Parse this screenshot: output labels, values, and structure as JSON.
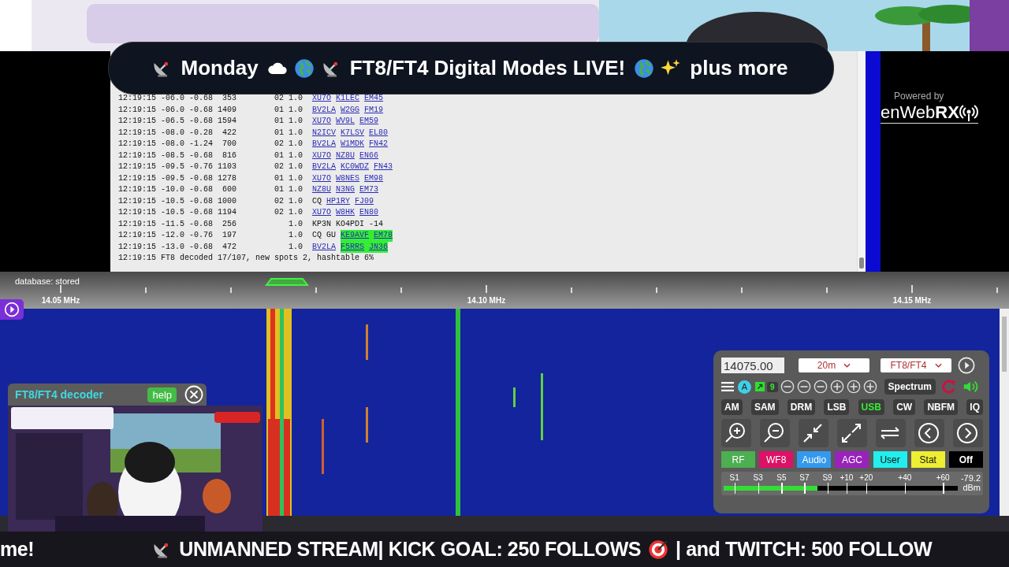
{
  "title": {
    "day": "Monday",
    "headline": "FT8/FT4 Digital Modes LIVE!",
    "tail": "plus more"
  },
  "log": {
    "rows": [
      {
        "time": "12:19:15",
        "snr": "-06.0",
        "dt": "-0.68",
        "freq": "353",
        "col_5": "02",
        "col_6": "1.0",
        "message": [
          {
            "text": "XU7O",
            "link": true,
            "highlight": false
          },
          {
            "text": "K1LEC",
            "link": true,
            "highlight": false
          },
          {
            "text": "EM45",
            "link": true,
            "highlight": false
          }
        ]
      },
      {
        "time": "12:19:15",
        "snr": "-06.0",
        "dt": "-0.68",
        "freq": "1409",
        "col_5": "01",
        "col_6": "1.0",
        "message": [
          {
            "text": "BV2LA",
            "link": true,
            "highlight": false
          },
          {
            "text": "W2GG",
            "link": true,
            "highlight": false
          },
          {
            "text": "FM19",
            "link": true,
            "highlight": false
          }
        ]
      },
      {
        "time": "12:19:15",
        "snr": "-06.5",
        "dt": "-0.68",
        "freq": "1594",
        "col_5": "01",
        "col_6": "1.0",
        "message": [
          {
            "text": "XU7O",
            "link": true,
            "highlight": false
          },
          {
            "text": "WV9L",
            "link": true,
            "highlight": false
          },
          {
            "text": "EM59",
            "link": true,
            "highlight": false
          }
        ]
      },
      {
        "time": "12:19:15",
        "snr": "-08.0",
        "dt": "-0.28",
        "freq": "422",
        "col_5": "01",
        "col_6": "1.0",
        "message": [
          {
            "text": "N2ICV",
            "link": true,
            "highlight": false
          },
          {
            "text": "K7LSV",
            "link": true,
            "highlight": false
          },
          {
            "text": "EL80",
            "link": true,
            "highlight": false
          }
        ]
      },
      {
        "time": "12:19:15",
        "snr": "-08.0",
        "dt": "-1.24",
        "freq": "700",
        "col_5": "02",
        "col_6": "1.0",
        "message": [
          {
            "text": "BV2LA",
            "link": true,
            "highlight": false
          },
          {
            "text": "W1MDK",
            "link": true,
            "highlight": false
          },
          {
            "text": "FN42",
            "link": true,
            "highlight": false
          }
        ]
      },
      {
        "time": "12:19:15",
        "snr": "-08.5",
        "dt": "-0.68",
        "freq": "816",
        "col_5": "01",
        "col_6": "1.0",
        "message": [
          {
            "text": "XU7O",
            "link": true,
            "highlight": false
          },
          {
            "text": "NZ8U",
            "link": true,
            "highlight": false
          },
          {
            "text": "EN66",
            "link": true,
            "highlight": false
          }
        ]
      },
      {
        "time": "12:19:15",
        "snr": "-09.5",
        "dt": "-0.76",
        "freq": "1103",
        "col_5": "02",
        "col_6": "1.0",
        "message": [
          {
            "text": "BV2LA",
            "link": true,
            "highlight": false
          },
          {
            "text": "KC0WDZ",
            "link": true,
            "highlight": false
          },
          {
            "text": "FN43",
            "link": true,
            "highlight": false
          }
        ]
      },
      {
        "time": "12:19:15",
        "snr": "-09.5",
        "dt": "-0.68",
        "freq": "1278",
        "col_5": "01",
        "col_6": "1.0",
        "message": [
          {
            "text": "XU7O",
            "link": true,
            "highlight": false
          },
          {
            "text": "W8NES",
            "link": true,
            "highlight": false
          },
          {
            "text": "EM98",
            "link": true,
            "highlight": false
          }
        ]
      },
      {
        "time": "12:19:15",
        "snr": "-10.0",
        "dt": "-0.68",
        "freq": "600",
        "col_5": "01",
        "col_6": "1.0",
        "message": [
          {
            "text": "NZ8U",
            "link": true,
            "highlight": false
          },
          {
            "text": "N3NG",
            "link": true,
            "highlight": false
          },
          {
            "text": "EM73",
            "link": true,
            "highlight": false
          }
        ]
      },
      {
        "time": "12:19:15",
        "snr": "-10.5",
        "dt": "-0.68",
        "freq": "1000",
        "col_5": "02",
        "col_6": "1.0",
        "message": [
          {
            "text": "CQ",
            "link": false,
            "highlight": false
          },
          {
            "text": "HP1RY",
            "link": true,
            "highlight": false
          },
          {
            "text": "FJ09",
            "link": true,
            "highlight": false
          }
        ]
      },
      {
        "time": "12:19:15",
        "snr": "-10.5",
        "dt": "-0.68",
        "freq": "1194",
        "col_5": "02",
        "col_6": "1.0",
        "message": [
          {
            "text": "XU7O",
            "link": true,
            "highlight": false
          },
          {
            "text": "W8HK",
            "link": true,
            "highlight": false
          },
          {
            "text": "EN80",
            "link": true,
            "highlight": false
          }
        ]
      },
      {
        "time": "12:19:15",
        "snr": "-11.5",
        "dt": "-0.68",
        "freq": "256",
        "col_6": "1.0",
        "message": [
          {
            "text": "KP3N",
            "link": false,
            "highlight": false
          },
          {
            "text": "KO4PDI",
            "link": false,
            "highlight": false
          },
          {
            "text": "-14",
            "link": false,
            "highlight": false
          }
        ]
      },
      {
        "time": "12:19:15",
        "snr": "-12.0",
        "dt": "-0.76",
        "freq": "197",
        "col_6": "1.0",
        "message": [
          {
            "text": "CQ GU",
            "link": false,
            "highlight": false
          },
          {
            "text": "KE9AVF",
            "link": true,
            "highlight": true
          },
          {
            "text": "EM78",
            "link": true,
            "highlight": true
          }
        ]
      },
      {
        "time": "12:19:15",
        "snr": "-13.0",
        "dt": "-0.68",
        "freq": "472",
        "col_6": "1.0",
        "message": [
          {
            "text": "BV2LA",
            "link": true,
            "highlight": false
          },
          {
            "text": "F5RRS",
            "link": true,
            "highlight": true
          },
          {
            "text": "JN36",
            "link": true,
            "highlight": true
          }
        ]
      }
    ],
    "summary": "12:19:15 FT8 decoded 17/107, new spots 2, hashtable 6%"
  },
  "brand": {
    "caption": "Powered by",
    "logo": "enWeb**RX**"
  },
  "ruler": {
    "status": "database: stored",
    "labels": [
      "14.05 MHz",
      "14.10 MHz",
      "14.15 MHz"
    ]
  },
  "decoder_panel": {
    "title": "FT8/FT4 decoder",
    "help": "help"
  },
  "receiver": {
    "frequency": "14075.00",
    "band": "20m",
    "profile": "FT8/FT4",
    "avatar": "A",
    "squelch": "9",
    "spectrum": "Spectrum",
    "modes": [
      {
        "label": "AM",
        "selected": false
      },
      {
        "label": "SAM",
        "selected": false
      },
      {
        "label": "DRM",
        "selected": false
      },
      {
        "label": "LSB",
        "selected": false
      },
      {
        "label": "USB",
        "selected": true
      },
      {
        "label": "CW",
        "selected": false
      },
      {
        "label": "NBFM",
        "selected": false
      },
      {
        "label": "IQ",
        "selected": false
      }
    ],
    "tabs": [
      {
        "label": "RF",
        "color": "#4caf50"
      },
      {
        "label": "WF8",
        "color": "#dd1166"
      },
      {
        "label": "Audio",
        "color": "#3399ee"
      },
      {
        "label": "AGC",
        "color": "#9922bb"
      },
      {
        "label": "User",
        "color": "#22eeee"
      },
      {
        "label": "Stat",
        "color": "#eeee33"
      },
      {
        "label": "Off",
        "color": "#000000"
      }
    ],
    "smeter": {
      "scale": [
        "S1",
        "S3",
        "S5",
        "S7",
        "S9",
        "+10",
        "+20",
        "+40",
        "+60"
      ],
      "reading": "-79.2",
      "unit": "dBm",
      "level": 0.4
    }
  },
  "ticker": [
    "me!",
    "UNMANNED STREAM| KICK GOAL: 250 FOLLOWS",
    "| and TWITCH: 500 FOLLOW"
  ]
}
